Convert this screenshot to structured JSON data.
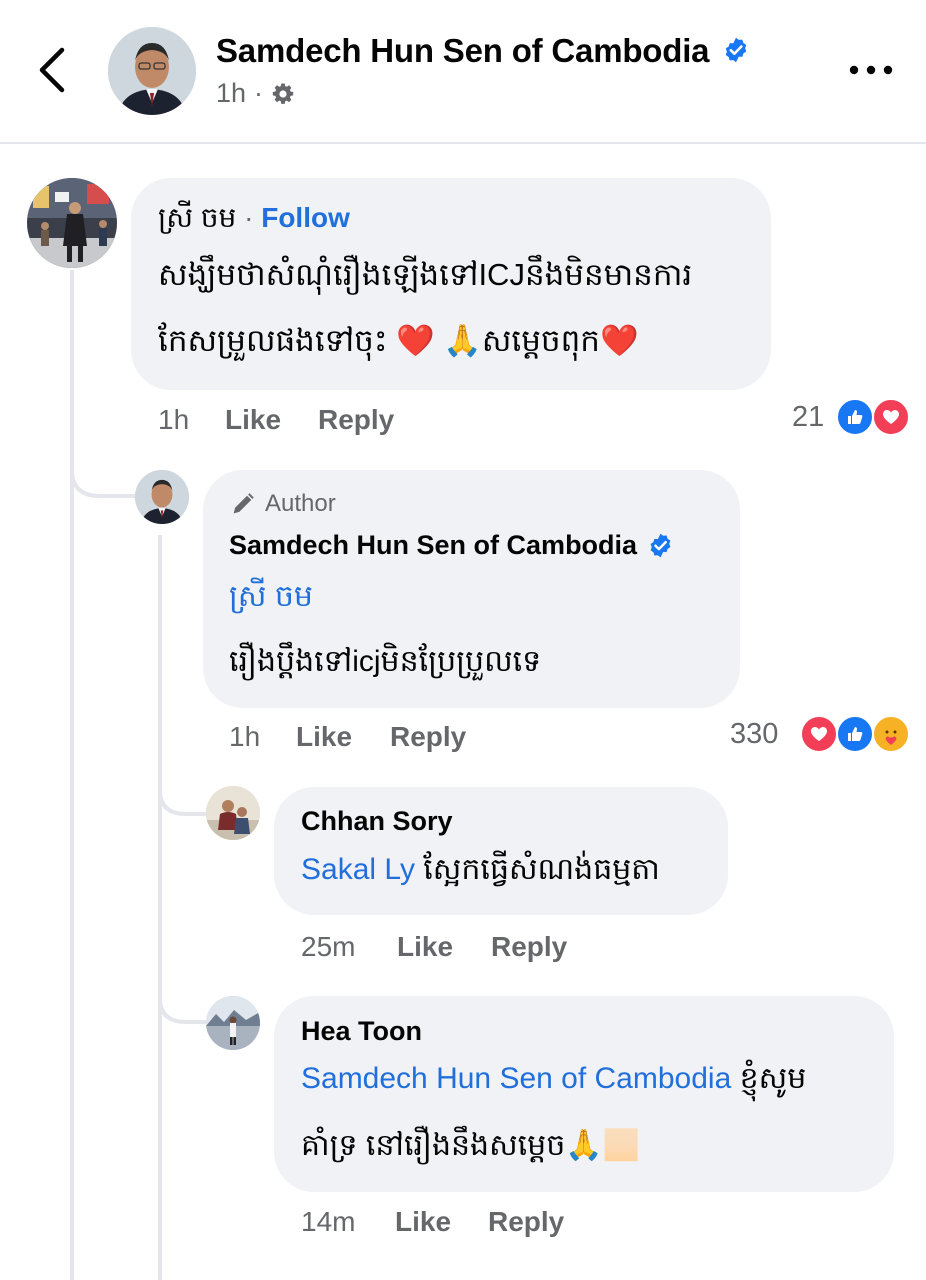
{
  "header": {
    "page_name": "Samdech Hun Sen of Cambodia",
    "time": "1h",
    "separator": "·"
  },
  "comments": [
    {
      "author": "ស្រី ចម",
      "dot": "·",
      "follow_label": "Follow",
      "text_line1": "សង្ឃឹមថាសំណុំរឿងឡើងទៅICJនឹងមិនមានការ",
      "text_line2": "កែសម្រួលផងទៅចុះ ❤️ 🙏សម្តេចពុក❤️",
      "time": "1h",
      "like_label": "Like",
      "reply_label": "Reply",
      "reaction_count": "21"
    },
    {
      "badge": "Author",
      "author": "Samdech Hun Sen of Cambodia",
      "mention": "ស្រី ចម",
      "text": "រឿងប្តឹងទៅicjមិនប្រែប្រួលទេ",
      "time": "1h",
      "like_label": "Like",
      "reply_label": "Reply",
      "reaction_count": "330"
    },
    {
      "author": "Chhan Sory",
      "mention": "Sakal Ly",
      "text": " ស្អែកធ្វើសំណង់ធម្មតា",
      "time": "25m",
      "like_label": "Like",
      "reply_label": "Reply"
    },
    {
      "author": "Hea Toon",
      "mention": "Samdech Hun Sen of Cambodia",
      "text_line1": " ខ្ញុំសូម",
      "text_line2": "គាំទ្រ នៅរឿងនឹងសម្តេច🙏🏻",
      "time": "14m",
      "like_label": "Like",
      "reply_label": "Reply"
    }
  ],
  "colors": {
    "link_blue": "#216fdb",
    "bubble_bg": "#f0f2f5",
    "secondary_text": "#65676b",
    "like_blue": "#1877f2",
    "love_red": "#f33e58"
  },
  "icons": [
    "back-arrow-icon",
    "verified-badge-icon",
    "settings-gear-icon",
    "more-icon",
    "pen-icon",
    "like-reaction-icon",
    "love-reaction-icon",
    "care-reaction-icon"
  ]
}
